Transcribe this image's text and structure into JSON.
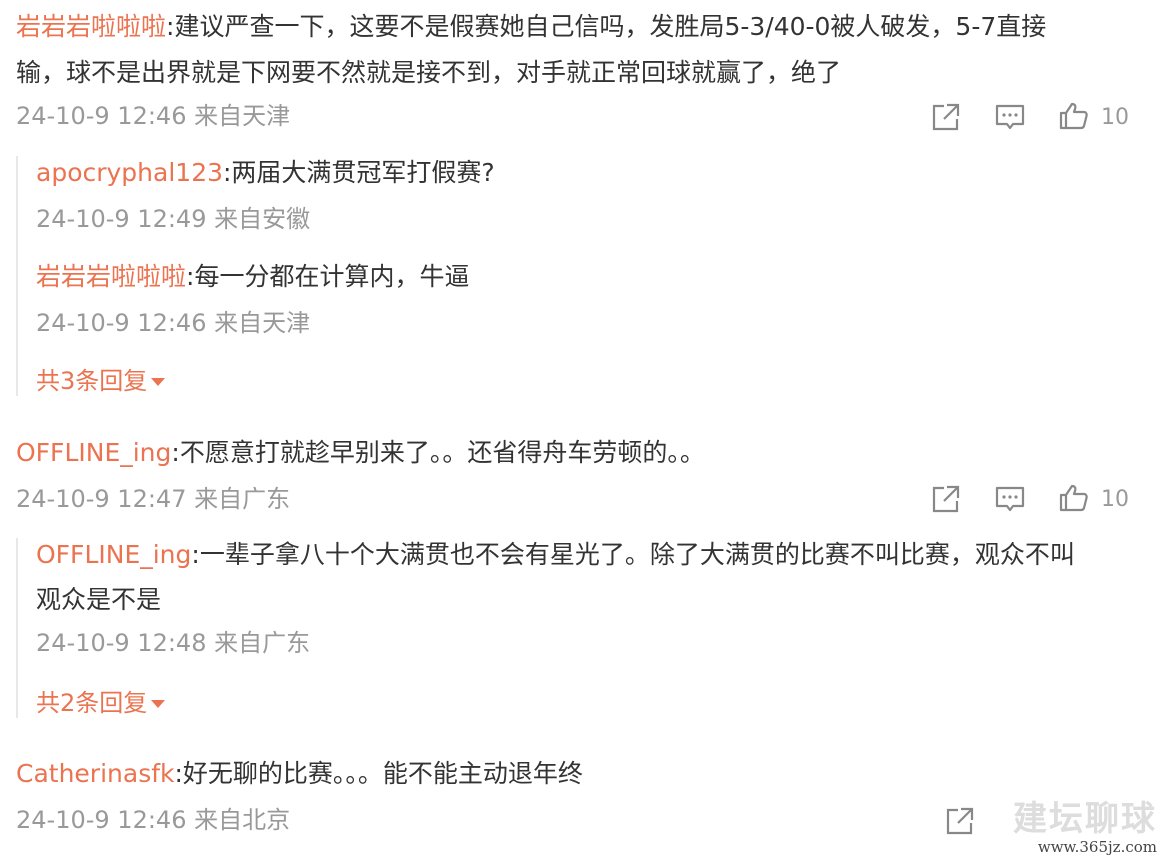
{
  "comments": [
    {
      "user": "岩岩岩啦啦啦",
      "text_line1": ":建议严查一下，这要不是假赛她自己信吗，发胜局5-3/40-0被人破发，5-7直接",
      "text_line2": "输，球不是出界就是下网要不然就是接不到，对手就正常回球就赢了，绝了",
      "meta": "24-10-9 12:46 来自天津",
      "likes": "10",
      "replies": [
        {
          "user": "apocryphal123",
          "text": ":两届大满贯冠军打假赛?",
          "meta": "24-10-9 12:49 来自安徽"
        },
        {
          "user": "岩岩岩啦啦啦",
          "text": ":每一分都在计算内，牛逼",
          "meta": "24-10-9 12:46 来自天津"
        }
      ],
      "more_replies": "共3条回复"
    },
    {
      "user": "OFFLINE_ing",
      "text_line1": ":不愿意打就趁早别来了。。还省得舟车劳顿的。。",
      "meta": "24-10-9 12:47 来自广东",
      "likes": "10",
      "replies": [
        {
          "user": "OFFLINE_ing",
          "text_line1": ":一辈子拿八十个大满贯也不会有星光了。除了大满贯的比赛不叫比赛，观众不叫",
          "text_line2": "观众是不是",
          "meta": "24-10-9 12:48 来自广东"
        }
      ],
      "more_replies": "共2条回复"
    },
    {
      "user": "Catherinasfk",
      "text_line1": ":好无聊的比赛。。。能不能主动退年终",
      "meta": "24-10-9 12:46 来自北京"
    }
  ],
  "watermark": {
    "brand": "建坛聊球",
    "url": "www.365jz.com"
  },
  "icons": {
    "share": "share-icon",
    "comment": "comment-icon",
    "like": "like-icon"
  },
  "colors": {
    "username": "#eb7350",
    "text": "#333333",
    "meta": "#999999"
  }
}
